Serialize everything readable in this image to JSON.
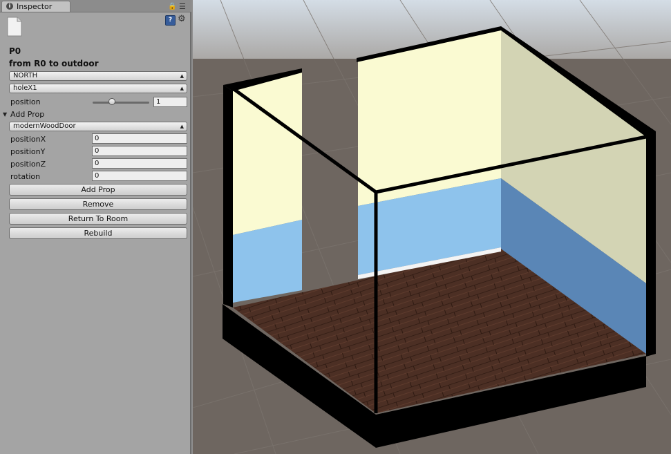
{
  "window": {
    "tab_title": "Inspector"
  },
  "inspector": {
    "object_name": "P0",
    "subtitle": "from R0 to outdoor",
    "direction_select": "NORTH",
    "hole_select": "holeX1",
    "position_label": "position",
    "position_value": 1,
    "position_value_text": "1",
    "add_prop_foldout": "Add Prop",
    "prop_select": "modernWoodDoor",
    "fields": [
      {
        "label": "positionX",
        "value": "0"
      },
      {
        "label": "positionY",
        "value": "0"
      },
      {
        "label": "positionZ",
        "value": "0"
      },
      {
        "label": "rotation",
        "value": "0"
      }
    ],
    "buttons": {
      "add_prop": "Add Prop",
      "remove": "Remove",
      "return_to_room": "Return To Room",
      "rebuild": "Rebuild"
    }
  },
  "icons": {
    "info": "info-icon",
    "lock": "lock-icon",
    "menu": "menu-icon",
    "file": "file-icon",
    "help": "help-book-icon",
    "gear": "gear-icon",
    "foldout": "triangle-down-icon"
  },
  "colors": {
    "panel_bg": "#a4a4a4",
    "scene_bg": "#6e6660",
    "sky": "#d8dfe6",
    "wall_cream": "#fafad2",
    "wall_blue": "#8ec3ec",
    "floor_wood": "#4a2e22"
  }
}
